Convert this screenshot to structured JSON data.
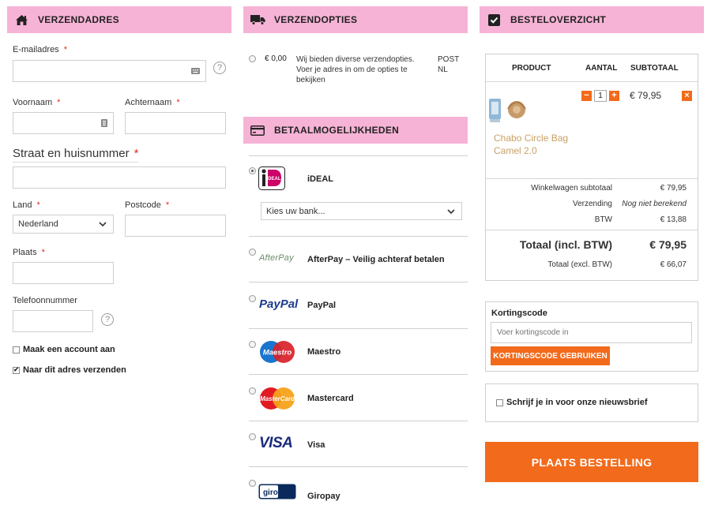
{
  "shipping_address": {
    "header_title": "VERZENDADRES",
    "email_label": "E-mailadres",
    "first_name_label": "Voornaam",
    "last_name_label": "Achternaam",
    "street_label": "Straat en huisnummer",
    "country_label": "Land",
    "country_value": "Nederland",
    "postcode_label": "Postcode",
    "city_label": "Plaats",
    "phone_label": "Telefoonnummer",
    "required_mark": "*",
    "help_glyph": "?",
    "create_account_label": "Maak een account aan",
    "create_account_checked": false,
    "ship_here_label": "Naar dit adres verzenden",
    "ship_here_checked": true
  },
  "shipping_options": {
    "header_title": "VERZENDOPTIES",
    "price": "€ 0,00",
    "description": "Wij bieden diverse verzendopties. Voer je adres in om de opties te bekijken",
    "carrier": "POST NL"
  },
  "payment": {
    "header_title": "BETAALMOGELIJKHEDEN",
    "bank_select_value": "Kies uw bank...",
    "selected_index": 0,
    "methods": [
      {
        "name": "iDEAL",
        "icon": "ideal-logo",
        "logo_text": "iDEAL"
      },
      {
        "name": "AfterPay – Veilig achteraf betalen",
        "icon": "afterpay-logo",
        "logo_text": "AfterPay"
      },
      {
        "name": "PayPal",
        "icon": "paypal-logo",
        "logo_text": "PayPal"
      },
      {
        "name": "Maestro",
        "icon": "maestro-logo",
        "logo_text": "Maestro"
      },
      {
        "name": "Mastercard",
        "icon": "mastercard-logo",
        "logo_text": "MasterCard"
      },
      {
        "name": "Visa",
        "icon": "visa-logo",
        "logo_text": "VISA"
      },
      {
        "name": "Giropay",
        "icon": "giropay-logo",
        "logo_text": "giropay"
      }
    ]
  },
  "order_summary": {
    "header_title": "BESTELOVERZICHT",
    "col_product": "PRODUCT",
    "col_quantity": "AANTAL",
    "col_subtotal": "SUBTOTAAL",
    "item": {
      "name": "Chabo Circle Bag Camel 2.0",
      "quantity": "1",
      "minus": "−",
      "plus": "+",
      "remove": "×",
      "subtotal": "€ 79,95"
    },
    "cart_subtotal_label": "Winkelwagen subtotaal",
    "cart_subtotal_value": "€ 79,95",
    "shipping_label": "Verzending",
    "shipping_value": "Nog niet berekend",
    "vat_label": "BTW",
    "vat_value": "€ 13,88",
    "total_incl_label": "Totaal (incl. BTW)",
    "total_incl_value": "€ 79,95",
    "total_excl_label": "Totaal (excl. BTW)",
    "total_excl_value": "€ 66,07"
  },
  "discount": {
    "title": "Kortingscode",
    "placeholder": "Voer kortingscode in",
    "button": "KORTINGSCODE GEBRUIKEN"
  },
  "newsletter": {
    "label": "Schrijf je in voor onze nieuwsbrief",
    "checked": false
  },
  "place_order": {
    "label": "PLAATS BESTELLING"
  },
  "colors": {
    "header_pink": "#f6b3d6",
    "accent_orange": "#f26a1b",
    "required_red": "#e0301e",
    "product_name_tan": "#c9a063"
  }
}
